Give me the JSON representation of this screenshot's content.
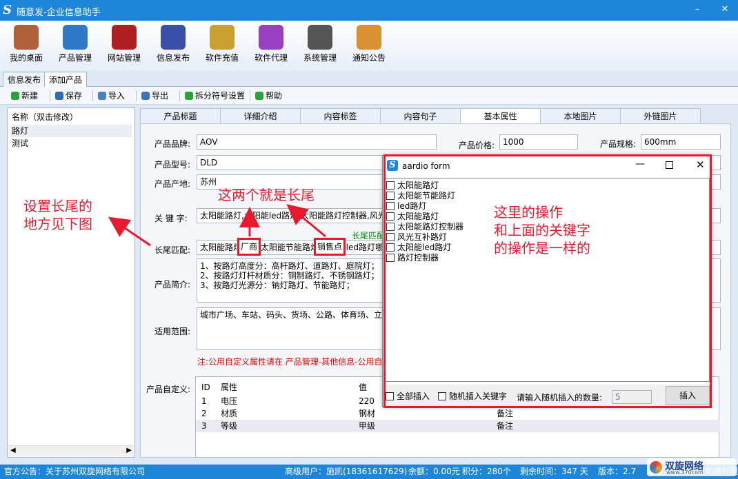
{
  "window": {
    "title": "随意发-企业信息助手",
    "logo": "S",
    "buttons": [
      "–",
      "✕"
    ]
  },
  "ribbon": [
    {
      "label": "我的桌面",
      "icon": "house-icon",
      "color": "#b0603a"
    },
    {
      "label": "产品管理",
      "icon": "cloud-drive-icon",
      "color": "#2f79c8"
    },
    {
      "label": "网站管理",
      "icon": "server-icon",
      "color": "#b02020"
    },
    {
      "label": "信息发布",
      "icon": "magic-wand-icon",
      "color": "#3a4fa8"
    },
    {
      "label": "软件充值",
      "icon": "money-bag-icon",
      "color": "#c9a030"
    },
    {
      "label": "软件代理",
      "icon": "gift-icon",
      "color": "#9a3fc0"
    },
    {
      "label": "系统管理",
      "icon": "gear-icon",
      "color": "#555555"
    },
    {
      "label": "通知公告",
      "icon": "notepad-icon",
      "color": "#d89030"
    }
  ],
  "tabs": [
    "信息发布",
    "添加产品"
  ],
  "toolbar": [
    {
      "label": "新建",
      "icon": "add-icon",
      "color": "#2aa33a"
    },
    {
      "label": "保存",
      "icon": "floppy-icon",
      "color": "#2f6ab5"
    },
    {
      "label": "导入",
      "icon": "folder-icon",
      "color": "#4a7fbf"
    },
    {
      "label": "导出",
      "icon": "export-icon",
      "color": "#3a73c2"
    },
    {
      "label": "拆分符号设置",
      "icon": "split-arrow-icon",
      "color": "#2aa33a"
    },
    {
      "label": "帮助",
      "icon": "help-icon",
      "color": "#2aa33a"
    }
  ],
  "left": {
    "header": "名称（双击修改）",
    "items": [
      "路灯",
      "测试"
    ]
  },
  "maintabs": [
    "产品标题",
    "详细介绍",
    "内容标签",
    "内容句子",
    "基本属性",
    "本地图片",
    "外链图片"
  ],
  "form": {
    "brand_label": "产品品牌:",
    "brand": "AOV",
    "price_label": "产品价格:",
    "price": "1000",
    "spec_label": "产品规格:",
    "spec": "600mm",
    "model_label": "产品型号:",
    "model": "DLD",
    "origin_label": "产品产地:",
    "origin": "苏州",
    "kw_label": "关 键 字:",
    "kw": "太阳能路灯,太阳能led路灯,太阳能路灯控制器,风光",
    "lt_hint": "长尾匹配",
    "lt_label": "长尾匹配:",
    "lt": "太阳能路灯厂商,太阳能节能路灯销售点,led路灯哪",
    "intro_label": "产品简介:",
    "intro": [
      "1、按路灯高度分：高杆路灯、道路灯、庭院灯；",
      "2、按路灯灯杆材质分：铜制路灯、不锈钢路灯；",
      "3、按路灯光源分：钠灯路灯、节能路灯；"
    ],
    "scope_label": "适用范围:",
    "scope": "城市广场、车站、码头、货场、公路、体育场、立",
    "note": "注:公用自定义属性请在 产品管理-其他信息-公用自",
    "custom_label": "产品自定义:"
  },
  "grid": {
    "headers": [
      "ID",
      "属性",
      "值"
    ],
    "rows": [
      [
        "1",
        "电压",
        "220",
        ""
      ],
      [
        "2",
        "材质",
        "钢材",
        "备注"
      ],
      [
        "3",
        "等级",
        "甲级",
        "备注"
      ]
    ]
  },
  "dialog": {
    "title": "aardio form",
    "logo": "S",
    "items": [
      "太阳能路灯",
      "太阳能节能路灯",
      "led路灯",
      "太阳能路灯",
      "太阳能路灯控制器",
      "风光互补路灯",
      "太阳能led路灯",
      "路灯控制器"
    ],
    "all_insert": "全部插入",
    "random_insert": "随机插入关键字",
    "count_label": "请输入随机插入的数量:",
    "count": "5",
    "insert": "插入"
  },
  "annotations": {
    "left": [
      "设置长尾的",
      "地方见下图"
    ],
    "top": "这两个就是长尾",
    "box1": "厂商",
    "box2": "销售点",
    "dialog": [
      "这里的操作",
      "和上面的关键字",
      "的操作是一样的"
    ]
  },
  "status": {
    "notice": "官方公告：关于苏州双旋网络有限公司",
    "user": "高级用户：施凯(18361617629)",
    "balance": "余额：0.00元",
    "points": "积分：280个",
    "remain": "剩余时间：347 天",
    "version": "版本：2.7",
    "copy": "版权：苏州双旋网络有限",
    "brand": "双旋网络",
    "brand_url": "www.370com"
  }
}
